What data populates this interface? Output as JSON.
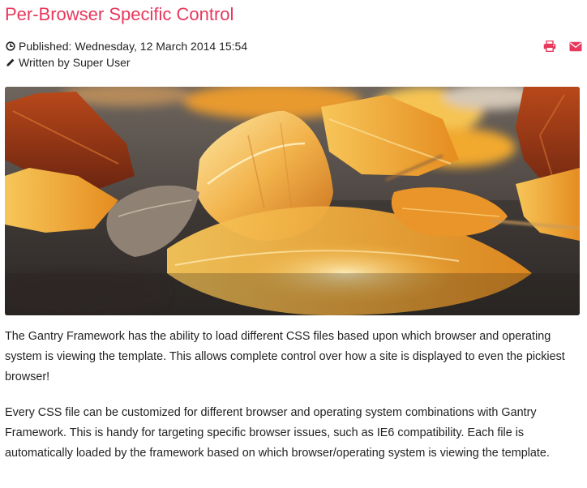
{
  "article": {
    "title": "Per-Browser Specific Control",
    "published_label": "Published:",
    "published_date": "Wednesday, 12 March 2014 15:54",
    "author_label": "Written by",
    "author_name": "Super User",
    "icons": {
      "published": "clock-icon",
      "author": "pencil-icon",
      "print": "print-icon",
      "email": "envelope-icon"
    },
    "image": {
      "subject": "autumn-leaves-photo"
    },
    "paragraphs": [
      "The Gantry Framework has the ability to load different CSS files based upon which browser and operating system is viewing the template. This allows complete control over how a site is displayed to even the pickiest browser!",
      "Every CSS file can be customized for different browser and operating system combinations with Gantry Framework. This is handy for targeting specific browser issues, such as IE6 compatibility. Each file is automatically loaded by the framework based on which browser/operating system is viewing the template."
    ]
  },
  "colors": {
    "accent": "#e8385c",
    "text": "#222222",
    "background": "#ffffff"
  }
}
